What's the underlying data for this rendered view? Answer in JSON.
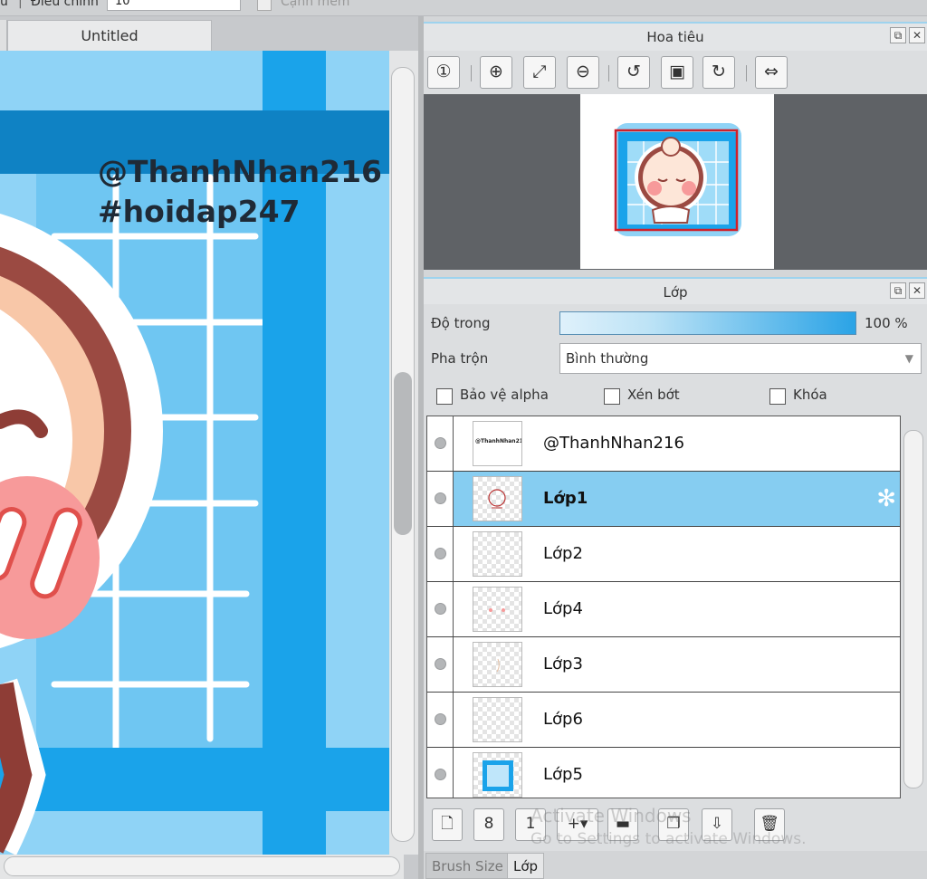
{
  "topbar": {
    "left_label": "u",
    "adjust_label": "Điều chỉnh",
    "adjust_value": "10",
    "option_label": "Cạnh mềm"
  },
  "document": {
    "tab_title": "Untitled",
    "watermark_line1": "@ThanhNhan216",
    "watermark_line2": "#hoidap247"
  },
  "navigator": {
    "title": "Hoa tiêu",
    "tools": [
      "zoom-actual-icon",
      "zoom-in-icon",
      "fit-window-icon",
      "zoom-out-icon",
      "rotate-left-icon",
      "reset-view-icon",
      "rotate-right-icon",
      "flip-horizontal-icon"
    ]
  },
  "layers": {
    "title": "Lớp",
    "opacity_label": "Độ trong",
    "opacity_value": "100 %",
    "opacity_fraction": 1.0,
    "blend_label": "Pha trộn",
    "blend_value": "Bình thường",
    "checkboxes": {
      "alpha_protect": "Bảo vệ alpha",
      "clipping": "Xén bớt",
      "lock": "Khóa"
    },
    "items": [
      {
        "name": "@ThanhNhan216",
        "selected": false,
        "thumb_text": "@ThanhNhan216 #hoidap247"
      },
      {
        "name": "Lớp1",
        "selected": true
      },
      {
        "name": "Lớp2",
        "selected": false
      },
      {
        "name": "Lớp4",
        "selected": false
      },
      {
        "name": "Lớp3",
        "selected": false
      },
      {
        "name": "Lớp6",
        "selected": false
      },
      {
        "name": "Lớp5",
        "selected": false
      }
    ],
    "toolbar": [
      "new-layer-icon",
      "new-8bit-layer-icon",
      "new-1bit-layer-icon",
      "add-layer-menu-icon",
      "new-folder-icon",
      "duplicate-layer-icon",
      "merge-down-icon",
      "delete-layer-icon"
    ]
  },
  "bottom_tabs": {
    "brush_size": "Brush Size",
    "layer": "Lớp"
  },
  "os_overlay": {
    "line1": "Activate Windows",
    "line2": "Go to Settings to activate Windows."
  },
  "colors": {
    "selection": "#86cdf1",
    "canvas_bg": "#8fd3f6",
    "panel": "#dcdee0"
  }
}
